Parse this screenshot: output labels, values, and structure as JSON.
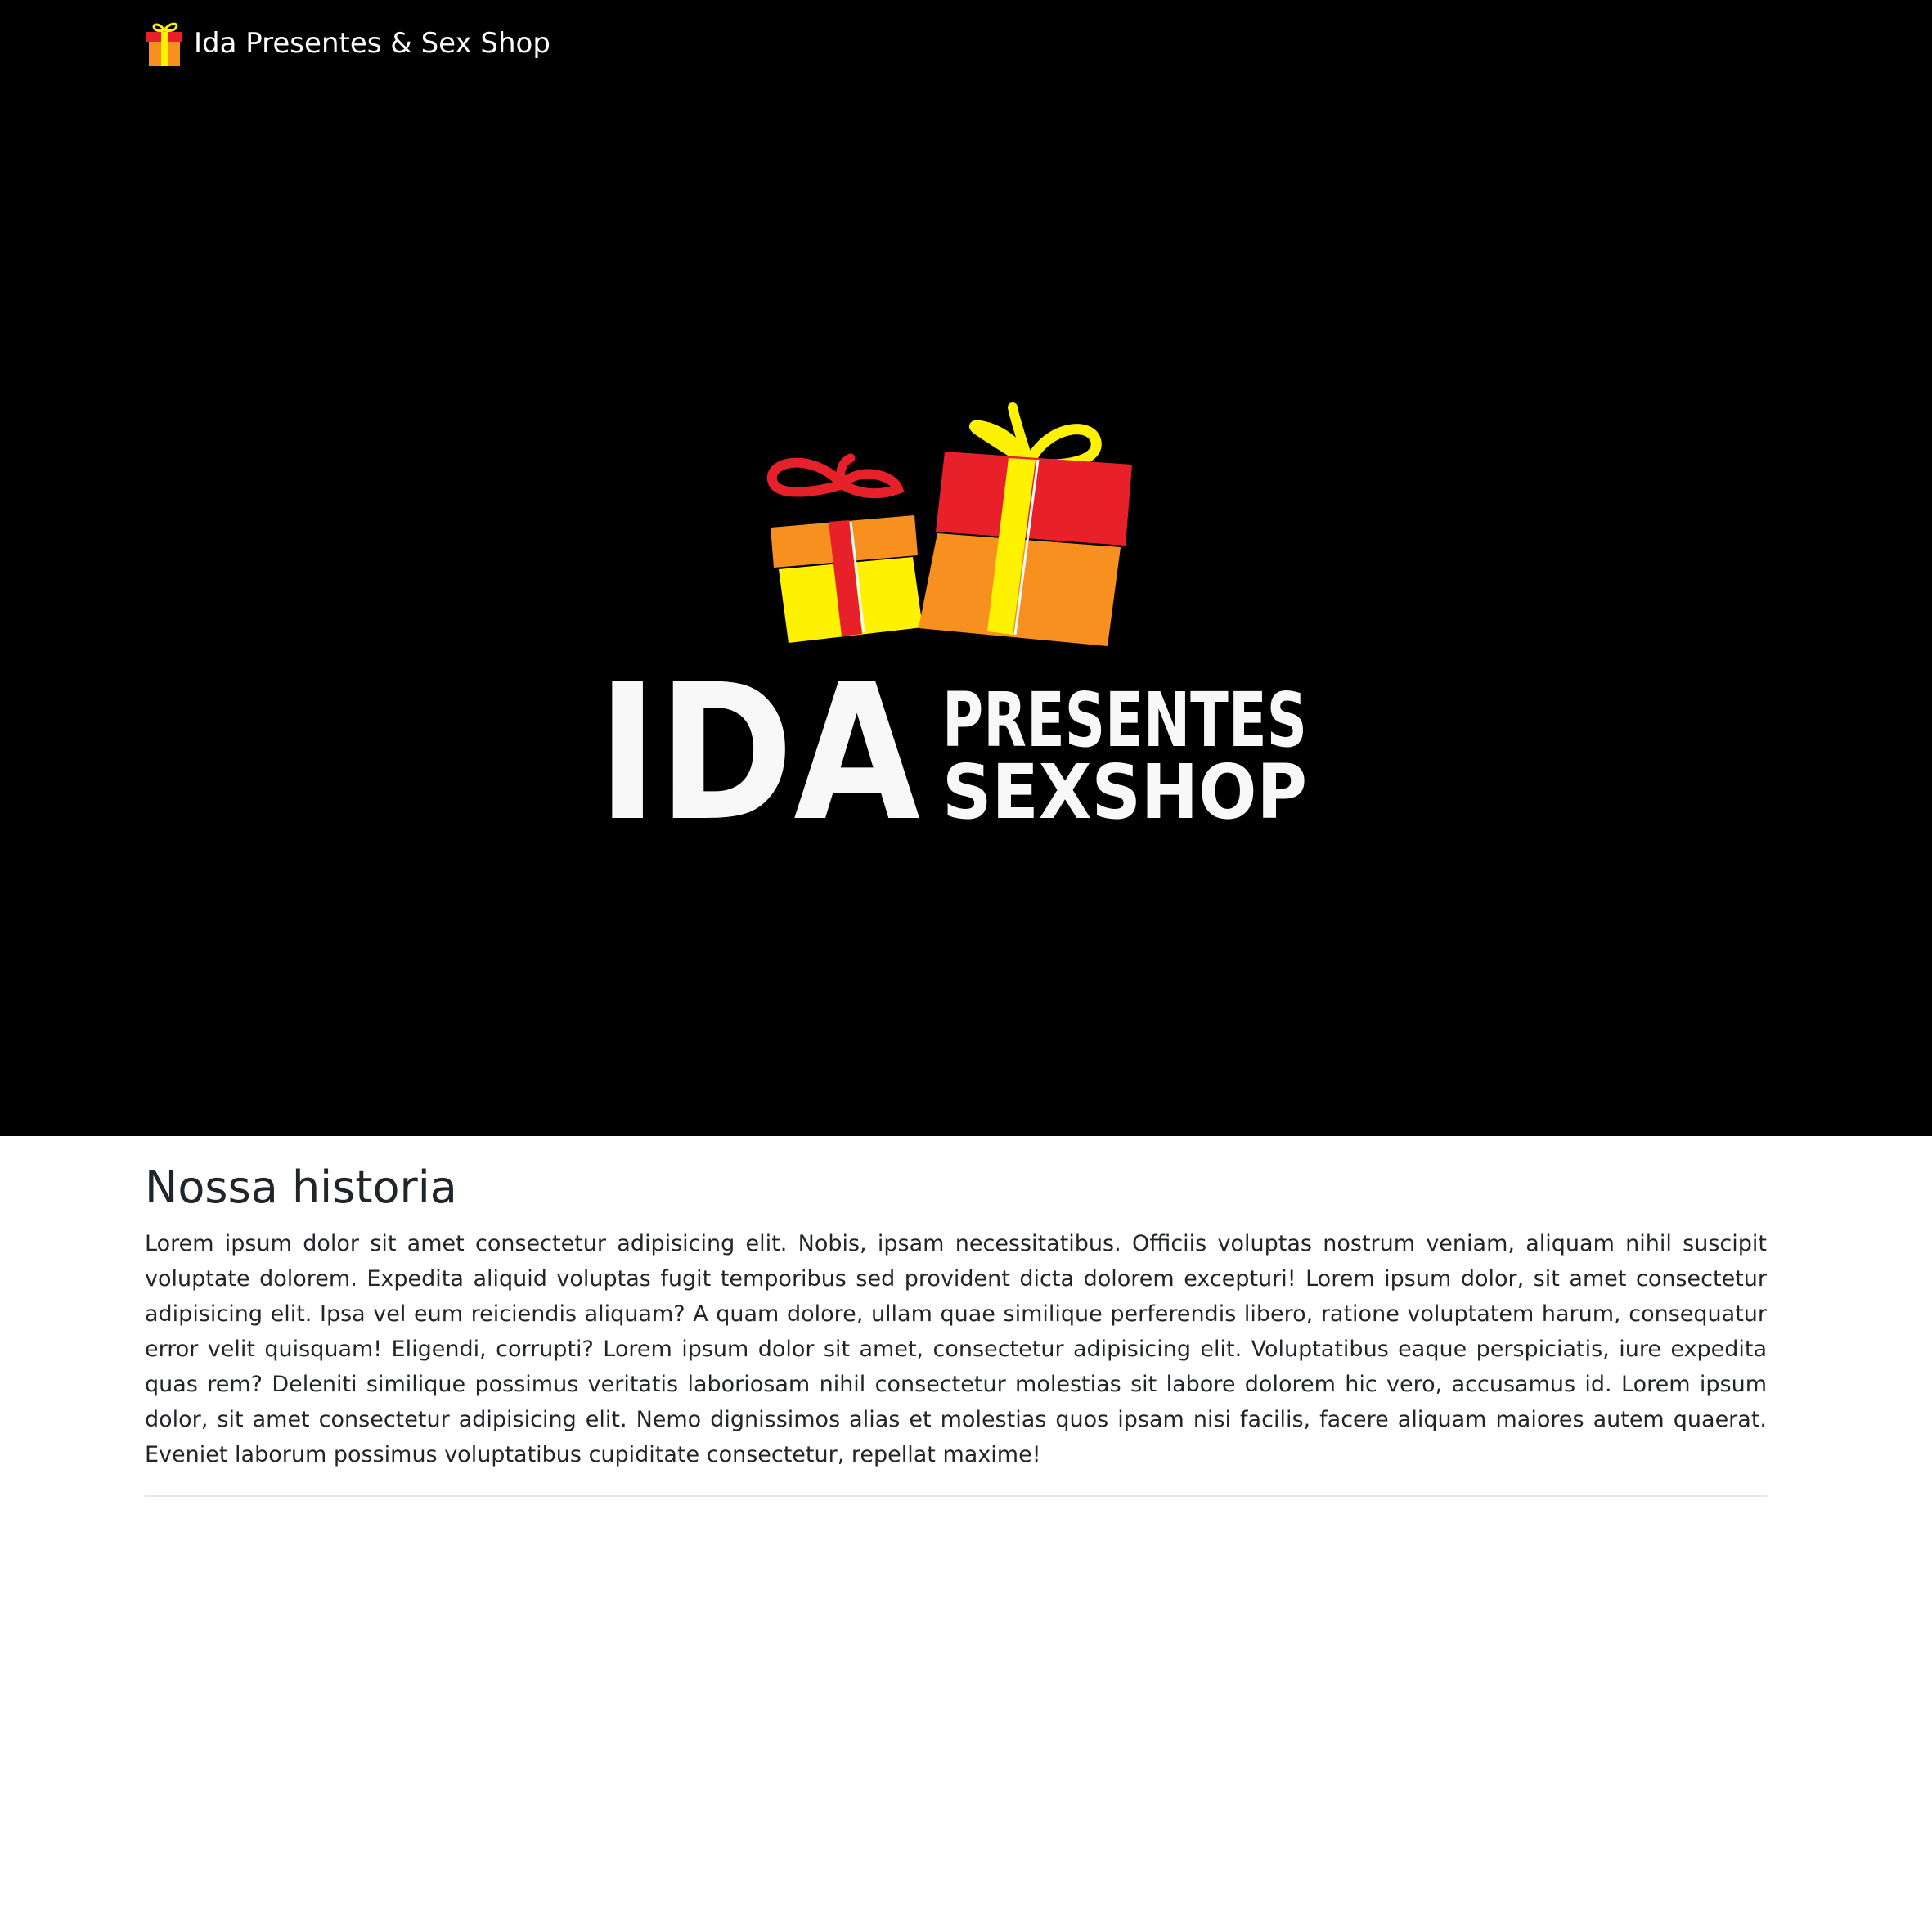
{
  "navbar": {
    "brand_name": "Ida Presentes & Sex Shop",
    "brand_icon": "gift-icon"
  },
  "hero": {
    "logo": {
      "main_word": "IDA",
      "line1": "PRESENTES",
      "line2": "SEXSHOP",
      "icon": "gift-boxes-icon"
    }
  },
  "about": {
    "title": "Nossa historia",
    "body": "Lorem ipsum dolor sit amet consectetur adipisicing elit. Nobis, ipsam necessitatibus. Officiis voluptas nostrum veniam, aliquam nihil suscipit voluptate dolorem. Expedita aliquid voluptas fugit temporibus sed provident dicta dolorem excepturi! Lorem ipsum dolor, sit amet consectetur adipisicing elit. Ipsa vel eum reiciendis aliquam? A quam dolore, ullam quae similique perferendis libero, ratione voluptatem harum, consequatur error velit quisquam! Eligendi, corrupti? Lorem ipsum dolor sit amet, consectetur adipisicing elit. Voluptatibus eaque perspiciatis, iure expedita quas rem? Deleniti similique possimus veritatis laboriosam nihil consectetur molestias sit labore dolorem hic vero, accusamus id. Lorem ipsum dolor, sit amet consectetur adipisicing elit. Nemo dignissimos alias et molestias quos ipsam nisi facilis, facere aliquam maiores autem quaerat. Eveniet laborum possimus voluptatibus cupiditate consectetur, repellat maxime!"
  },
  "colors": {
    "hero_background": "#000000",
    "gift_red": "#e8202a",
    "gift_yellow": "#fff200",
    "gift_orange": "#f7901e",
    "logo_text": "#f8f8f8",
    "body_text": "#212529"
  }
}
